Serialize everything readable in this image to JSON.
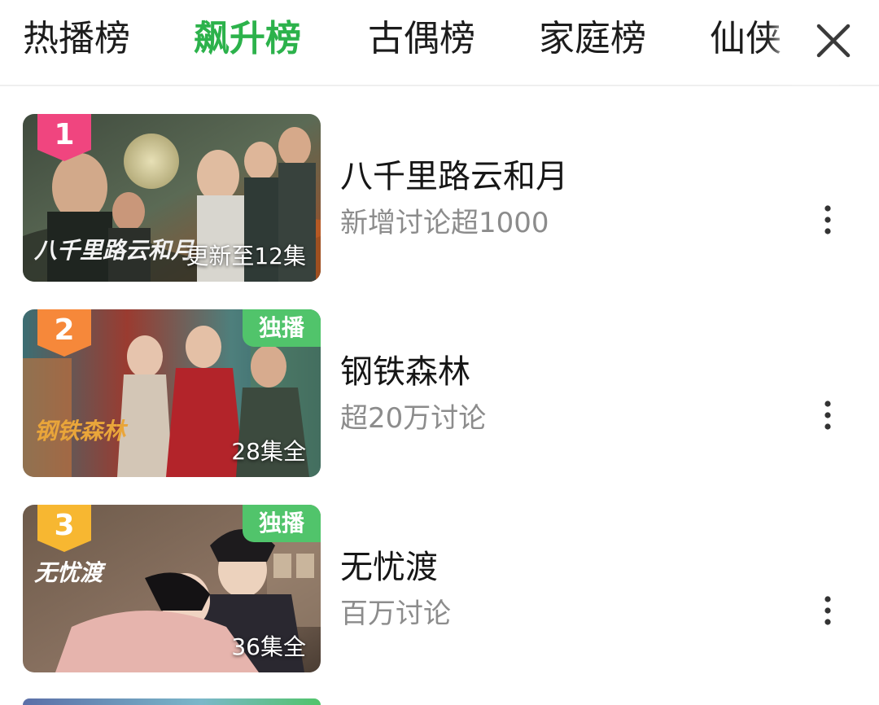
{
  "tabs": [
    {
      "label": "热播榜",
      "active": false
    },
    {
      "label": "飙升榜",
      "active": true
    },
    {
      "label": "古偶榜",
      "active": false
    },
    {
      "label": "家庭榜",
      "active": false
    },
    {
      "label": "仙侠",
      "active": false
    }
  ],
  "colors": {
    "accent": "#2cb24b",
    "badge": "#51c46b",
    "rank1": "#f0457f",
    "rank2": "#f6883a",
    "rank3": "#f7b731",
    "subtitle": "#8c8c8c"
  },
  "close_icon": "close-icon",
  "items": [
    {
      "rank": "1",
      "title": "八千里路云和月",
      "subtitle": "新增讨论超1000",
      "badge": "",
      "episode": "更新至12集",
      "poster_title": "八千里路云和月"
    },
    {
      "rank": "2",
      "title": "钢铁森林",
      "subtitle": "超20万讨论",
      "badge": "独播",
      "episode": "28集全",
      "poster_title": "钢铁森林"
    },
    {
      "rank": "3",
      "title": "无忧渡",
      "subtitle": "百万讨论",
      "badge": "独播",
      "episode": "36集全",
      "poster_title": "无忧渡"
    }
  ]
}
